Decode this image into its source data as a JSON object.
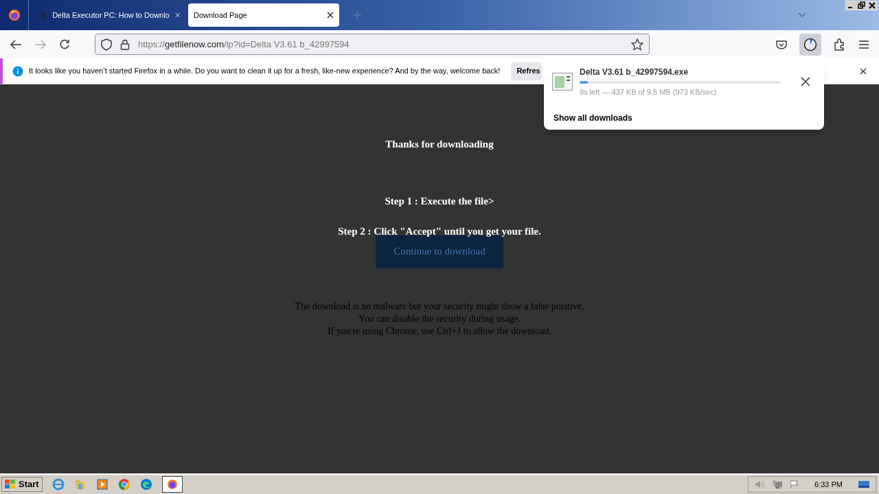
{
  "tabs": [
    {
      "title": "Delta Executor PC: How to Downlo",
      "selected": false
    },
    {
      "title": "Download Page",
      "selected": true
    }
  ],
  "address_bar": {
    "scheme": "https://",
    "domain": "getfilenow.com",
    "path": "/lp?id=Delta V3.61 b_42997594"
  },
  "notification": {
    "message": "It looks like you haven’t started Firefox in a while. Do you want to clean it up for a fresh, like-new experience? And by the way, welcome back!",
    "button": "Refres"
  },
  "downloads_panel": {
    "file_name": "Delta V3.61 b_42997594.exe",
    "level": 0.04,
    "status": "9s left — 437 KB of 9.5 MB (973 KB/sec)",
    "show_all": "Show all downloads"
  },
  "page": {
    "heading": "Thanks for downloading",
    "steps": [
      "Step 1 : Execute the file>",
      "Step 2 : Click \"Accept\" until you get your file."
    ],
    "button": "Continue to download",
    "notes": [
      "The download is no malware but your security might show a false positive.",
      "You can disable the security during usage.",
      "If you're using Chrome, use Ctrl+J to allow the download."
    ]
  },
  "taskbar": {
    "start": "Start",
    "clock": "6:33 PM"
  }
}
